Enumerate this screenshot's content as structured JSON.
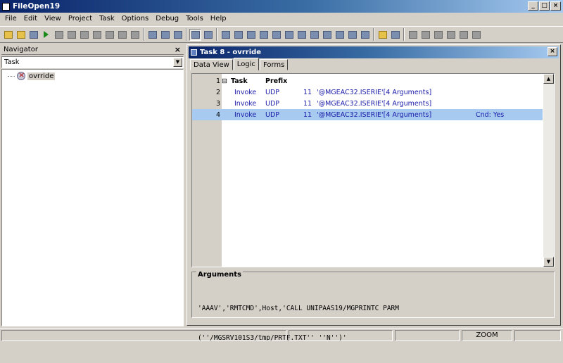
{
  "window": {
    "title": "FileOpen19",
    "minimize": "_",
    "maximize": "□",
    "close": "×"
  },
  "menu": [
    "File",
    "Edit",
    "View",
    "Project",
    "Task",
    "Options",
    "Debug",
    "Tools",
    "Help"
  ],
  "toolbar_icons": [
    "new-project-icon",
    "open-icon",
    "save-icon",
    "run-icon",
    "stop-icon",
    "step-icon",
    "pause-icon",
    "break-icon",
    "continue-icon",
    "cut-icon",
    "wand-icon",
    "align-icon",
    "find-icon",
    "list-icon",
    "copy-icon",
    "paste-icon",
    "undo-icon",
    "redo-icon",
    "doc-icon",
    "calc-icon",
    "props-icon",
    "expr-icon",
    "form-icon",
    "export-icon",
    "help-icon",
    "tool-icon",
    "window1-icon",
    "window2-icon",
    "window3-icon",
    "window4-icon",
    "window5-icon",
    "window6-icon"
  ],
  "navigator": {
    "title": "Navigator",
    "close": "×",
    "combo_value": "Task",
    "tree_item": "ovrride"
  },
  "task_window": {
    "title": "Task 8 -   ovrride",
    "close": "×"
  },
  "tabs": [
    "Data View",
    "Logic",
    "Forms"
  ],
  "logic": {
    "header": {
      "num": "1",
      "marker": "⊟",
      "task": "Task",
      "prefix": "Prefix"
    },
    "rows": [
      {
        "num": "2",
        "op": "Invoke",
        "type": "UDP",
        "arg": "11",
        "expr": "'@MGEAC32.ISERIE'[4 Arguments]",
        "cnd": ""
      },
      {
        "num": "3",
        "op": "Invoke",
        "type": "UDP",
        "arg": "11",
        "expr": "'@MGEAC32.ISERIE'[4 Arguments]",
        "cnd": ""
      },
      {
        "num": "4",
        "op": "Invoke",
        "type": "UDP",
        "arg": "11",
        "expr": "'@MGEAC32.ISERIE'[4 Arguments]",
        "cnd": "Cnd: Yes"
      }
    ]
  },
  "arguments": {
    "title": "Arguments",
    "line1": "'AAAV','RMTCMD',Host,'CALL UNIPAAS19/MGPRINTC PARM",
    "line2": "(''/MGSRV101S3/tmp/PRTF.TXT'' ''N'')'"
  },
  "status": {
    "zoom": "ZOOM"
  }
}
